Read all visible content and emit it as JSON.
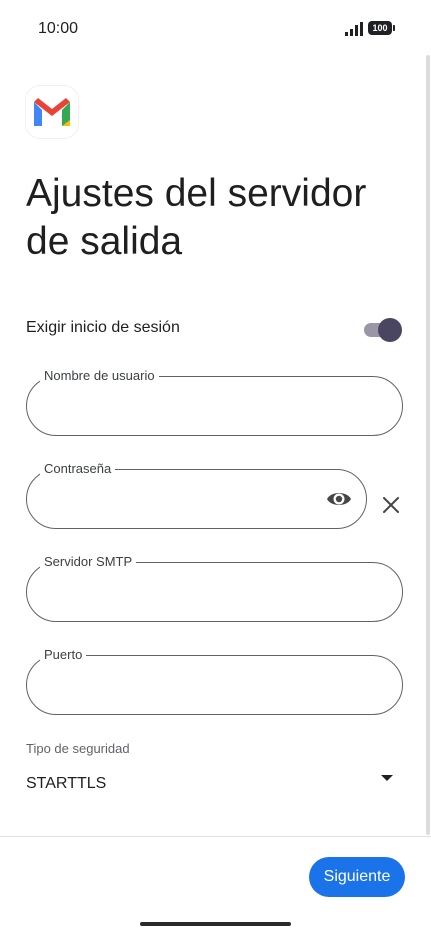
{
  "status_bar": {
    "time": "10:00",
    "battery": "100"
  },
  "title": "Ajustes del servidor de salida",
  "require_signin": {
    "label": "Exigir inicio de sesión",
    "enabled": true
  },
  "fields": {
    "username": {
      "label": "Nombre de usuario",
      "value": ""
    },
    "password": {
      "label": "Contraseña",
      "value": ""
    },
    "smtp_server": {
      "label": "Servidor SMTP",
      "value": ""
    },
    "port": {
      "label": "Puerto",
      "value": ""
    }
  },
  "security": {
    "label": "Tipo de seguridad",
    "value": "STARTTLS"
  },
  "actions": {
    "next_label": "Siguiente"
  },
  "colors": {
    "primary": "#1a73e8",
    "toggle_thumb": "#4a4560",
    "toggle_track": "#9a96a8"
  },
  "icons": [
    "signal-icon",
    "battery-icon",
    "gmail-logo-icon",
    "eye-icon",
    "close-icon",
    "chevron-down-icon"
  ]
}
